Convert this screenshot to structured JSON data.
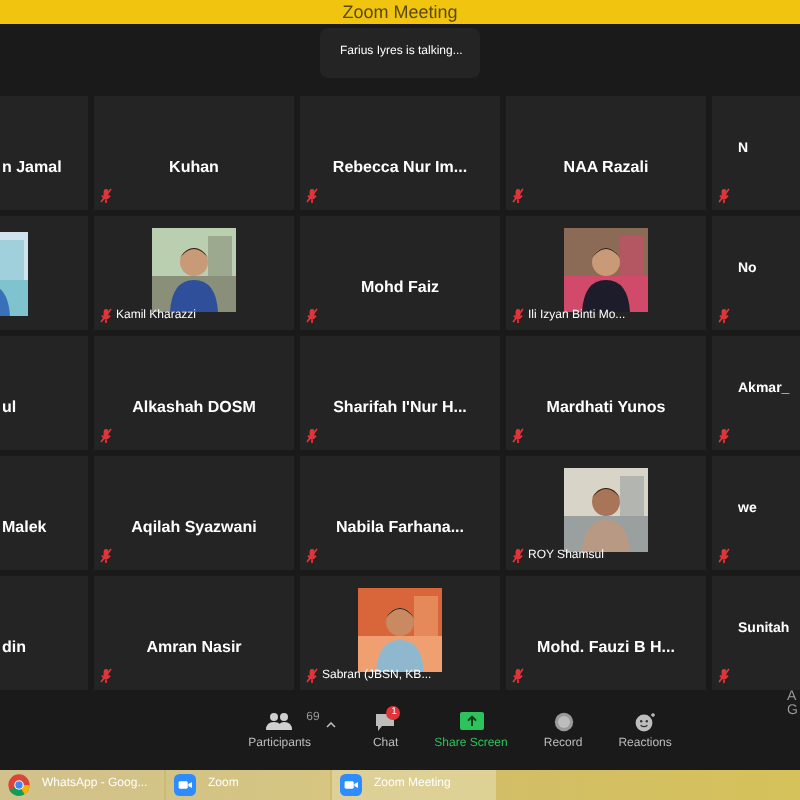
{
  "window": {
    "title": "Zoom Meeting"
  },
  "talking_banner": "Farius Iyres is talking...",
  "tiles": [
    [
      {
        "kind": "name",
        "name": "n Jamal",
        "muted": false
      },
      {
        "kind": "name",
        "name": "Kuhan",
        "muted": true
      },
      {
        "kind": "name",
        "name": "Rebecca Nur Im...",
        "muted": true
      },
      {
        "kind": "name",
        "name": "NAA Razali",
        "muted": true
      },
      {
        "kind": "name",
        "name": "N",
        "muted": true
      }
    ],
    [
      {
        "kind": "video",
        "muted": false
      },
      {
        "kind": "video",
        "name": "Kamil Kharazzi",
        "muted": true
      },
      {
        "kind": "name",
        "name": "Mohd Faiz",
        "muted": true
      },
      {
        "kind": "video",
        "name": "Ili Izyan Binti Mo...",
        "muted": true
      },
      {
        "kind": "name",
        "name": "No",
        "muted": true
      }
    ],
    [
      {
        "kind": "name",
        "name": "ul",
        "muted": false
      },
      {
        "kind": "name",
        "name": "Alkashah DOSM",
        "muted": true
      },
      {
        "kind": "name",
        "name": "Sharifah I'Nur H...",
        "muted": true
      },
      {
        "kind": "name",
        "name": "Mardhati Yunos",
        "muted": true
      },
      {
        "kind": "name",
        "name": "Akmar_",
        "muted": true
      }
    ],
    [
      {
        "kind": "name",
        "name": "Malek",
        "muted": false
      },
      {
        "kind": "name",
        "name": "Aqilah Syazwani",
        "muted": true
      },
      {
        "kind": "name",
        "name": "Nabila Farhana...",
        "muted": true
      },
      {
        "kind": "video",
        "name": "ROY Shamsul",
        "muted": true
      },
      {
        "kind": "name",
        "name": "we",
        "muted": true
      }
    ],
    [
      {
        "kind": "name",
        "name": "din",
        "muted": false
      },
      {
        "kind": "name",
        "name": "Amran Nasir",
        "muted": true
      },
      {
        "kind": "video",
        "name": "Sabran (JBSN, KB...",
        "muted": true
      },
      {
        "kind": "name",
        "name": "Mohd. Fauzi B H...",
        "muted": true
      },
      {
        "kind": "name",
        "name": "Sunitah",
        "muted": true
      }
    ]
  ],
  "side_text": [
    "A",
    "G"
  ],
  "toolbar": [
    {
      "kind": "participants",
      "label": "Participants",
      "count": "69"
    },
    {
      "kind": "chat",
      "label": "Chat",
      "badge": "1"
    },
    {
      "kind": "share",
      "label": "Share Screen"
    },
    {
      "kind": "record",
      "label": "Record"
    },
    {
      "kind": "reactions",
      "label": "Reactions"
    }
  ],
  "taskbar": [
    {
      "kind": "chrome",
      "label": "WhatsApp - Goog...",
      "selected": false
    },
    {
      "kind": "zoom",
      "label": "Zoom",
      "selected": false
    },
    {
      "kind": "zoom",
      "label": "Zoom Meeting",
      "selected": true
    }
  ]
}
